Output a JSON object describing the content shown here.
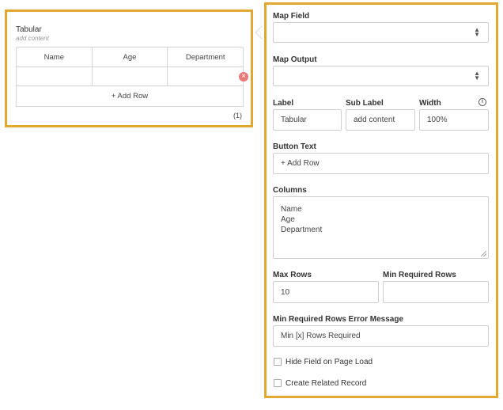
{
  "preview": {
    "title": "Tabular",
    "subtitle": "add content",
    "columns": [
      "Name",
      "Age",
      "Department"
    ],
    "add_row_label": "+ Add Row",
    "row_count": "(1)",
    "remove_symbol": "×"
  },
  "settings": {
    "map_field": {
      "label": "Map Field",
      "value": ""
    },
    "map_output": {
      "label": "Map Output",
      "value": ""
    },
    "label": {
      "label": "Label",
      "value": "Tabular"
    },
    "sub_label": {
      "label": "Sub Label",
      "value": "add content"
    },
    "width": {
      "label": "Width",
      "value": "100%"
    },
    "button_text": {
      "label": "Button Text",
      "value": "+ Add Row"
    },
    "columns": {
      "label": "Columns",
      "lines": [
        "Name",
        "Age",
        "Department"
      ]
    },
    "max_rows": {
      "label": "Max Rows",
      "value": "10"
    },
    "min_required_rows": {
      "label": "Min Required Rows",
      "value": ""
    },
    "min_rows_error": {
      "label": "Min Required Rows Error Message",
      "value": "Min [x] Rows Required"
    },
    "hide_field": {
      "label": "Hide Field on Page Load",
      "checked": false
    },
    "create_related": {
      "label": "Create Related Record",
      "checked": false
    }
  },
  "colors": {
    "accent_border": "#e0a82e",
    "remove": "#e87a7a"
  },
  "icons": {
    "info": "info-icon",
    "select": "chevron-updown-icon",
    "remove": "close-circle-icon"
  }
}
